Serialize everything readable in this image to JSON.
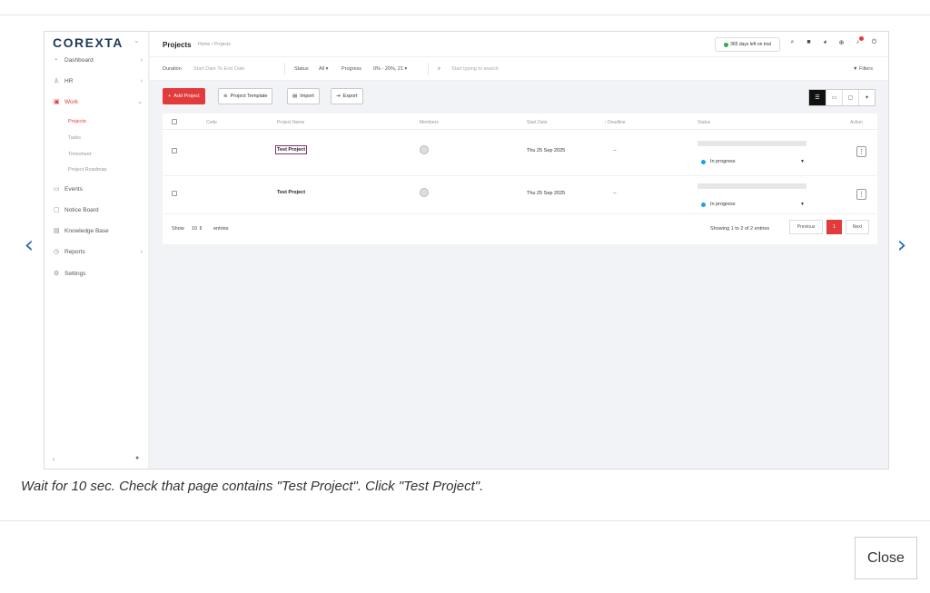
{
  "viewer": {
    "caption": "Wait for 10 sec. Check that page contains \"Test Project\". Click \"Test Project\".",
    "close_label": "Close",
    "prev_arrow": "‹",
    "next_arrow": "›"
  },
  "app": {
    "logo": "COREXTA",
    "sidebar": {
      "items": [
        {
          "label": "Dashboard",
          "icon": "dashboard-icon"
        },
        {
          "label": "HR",
          "icon": "people-icon"
        },
        {
          "label": "Work",
          "icon": "briefcase-icon"
        },
        {
          "label": "Events",
          "icon": "calendar-icon"
        },
        {
          "label": "Notice Board",
          "icon": "notice-icon"
        },
        {
          "label": "Knowledge Base",
          "icon": "book-icon"
        },
        {
          "label": "Reports",
          "icon": "chart-icon"
        },
        {
          "label": "Settings",
          "icon": "gear-icon"
        }
      ],
      "sub_items": [
        "Projects",
        "Tasks",
        "Timesheet",
        "Project Roadmap"
      ]
    },
    "header": {
      "title": "Projects",
      "breadcrumb": "Home • Projects",
      "trial": "365 days left on trial"
    },
    "filters": {
      "duration_label": "Duration",
      "duration_value": "Start Date To End Date",
      "status_label": "Status",
      "status_value": "All",
      "progress_label": "Progress",
      "progress_value": "0% - 20%, 21",
      "search_placeholder": "Start typing to search",
      "filters_label": "Filters"
    },
    "toolbar": {
      "add": "Add Project",
      "template": "Project Template",
      "import": "Import",
      "export": "Export"
    },
    "table": {
      "headers": [
        "Code",
        "Project Name",
        "Members",
        "Start Date",
        "Deadline",
        "Status",
        "Action"
      ],
      "rows": [
        {
          "name": "Test Project",
          "start": "Thu 25 Sep 2025",
          "deadline": "--",
          "status": "In progress"
        },
        {
          "name": "Test Project",
          "start": "Thu 25 Sep 2025",
          "deadline": "--",
          "status": "In progress"
        }
      ],
      "show": "Show",
      "show_value": "10",
      "entries": "entries",
      "info": "Showing 1 to 2 of 2 entries",
      "prev": "Previous",
      "page": "1",
      "next": "Next"
    }
  }
}
